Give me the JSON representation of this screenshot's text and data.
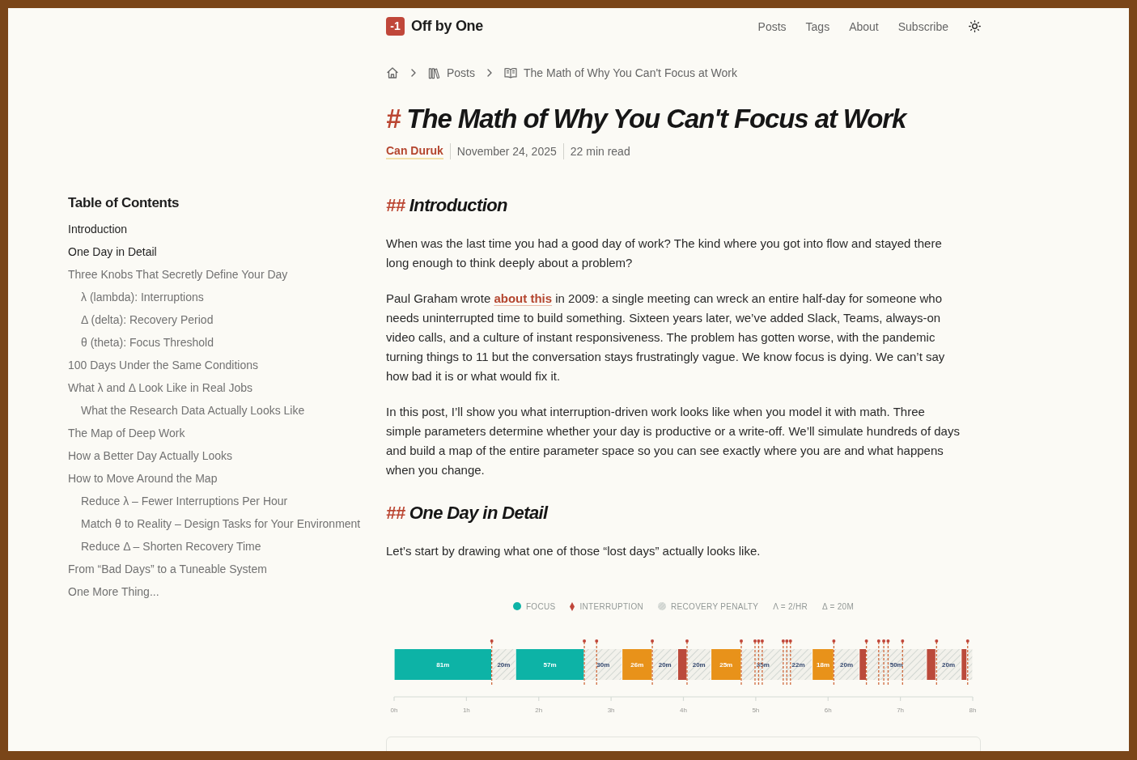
{
  "header": {
    "logo": {
      "mark": "-1",
      "name": "Off by One"
    },
    "nav": [
      {
        "label": "Posts"
      },
      {
        "label": "Tags"
      },
      {
        "label": "About"
      },
      {
        "label": "Subscribe"
      }
    ]
  },
  "toc": {
    "title": "Table of Contents",
    "items": [
      {
        "label": "Introduction",
        "active": true
      },
      {
        "label": "One Day in Detail",
        "active": true
      },
      {
        "label": "Three Knobs That Secretly Define Your Day",
        "active": false,
        "children": [
          {
            "label": "λ (lambda): Interruptions",
            "active": false
          },
          {
            "label": "Δ (delta): Recovery Period",
            "active": false
          },
          {
            "label": "θ (theta): Focus Threshold",
            "active": false
          }
        ]
      },
      {
        "label": "100 Days Under the Same Conditions",
        "active": false
      },
      {
        "label": "What λ and Δ Look Like in Real Jobs",
        "active": false,
        "children": [
          {
            "label": "What the Research Data Actually Looks Like",
            "active": false
          }
        ]
      },
      {
        "label": "The Map of Deep Work",
        "active": false
      },
      {
        "label": "How a Better Day Actually Looks",
        "active": false
      },
      {
        "label": "How to Move Around the Map",
        "active": false,
        "children": [
          {
            "label": "Reduce λ – Fewer Interruptions Per Hour",
            "active": false
          },
          {
            "label": "Match θ to Reality – Design Tasks for Your Environment",
            "active": false
          },
          {
            "label": "Reduce Δ – Shorten Recovery Time",
            "active": false
          }
        ]
      },
      {
        "label": "From “Bad Days” to a Tuneable System",
        "active": false
      },
      {
        "label": "One More Thing...",
        "active": false
      }
    ]
  },
  "breadcrumb": [
    {
      "kind": "home"
    },
    {
      "kind": "section",
      "label": "Posts"
    },
    {
      "kind": "page",
      "label": "The Math of Why You Can't Focus at Work"
    }
  ],
  "article": {
    "title": {
      "marker": "#",
      "text": "The Math of Why You Can't Focus at Work"
    },
    "meta": {
      "author": "Can Duruk",
      "date": "November 24, 2025",
      "read_time": "22 min read"
    },
    "blocks": [
      {
        "kind": "heading",
        "marker": "##",
        "text": "Introduction"
      },
      {
        "kind": "paragraph",
        "parts": [
          {
            "kind": "text",
            "text": "When was the last time you had a good day of work? The kind where you got into flow and stayed there long enough to think deeply about a problem?"
          }
        ]
      },
      {
        "kind": "paragraph",
        "parts": [
          {
            "kind": "text",
            "text": "Paul Graham wrote "
          },
          {
            "kind": "link",
            "text": "about this"
          },
          {
            "kind": "text",
            "text": " in 2009: a single meeting can wreck an entire half-day for someone who needs uninterrupted time to build something. Sixteen years later, we’ve added Slack, Teams, always-on video calls, and a culture of instant responsiveness. The problem has gotten worse, with the pandemic turning things to 11 but the conversation stays frustratingly vague. We know focus is dying. We can’t say how bad it is or what would fix it."
          }
        ]
      },
      {
        "kind": "paragraph",
        "parts": [
          {
            "kind": "text",
            "text": "In this post, I’ll show you what interruption-driven work looks like when you model it with math. Three simple parameters determine whether your day is productive or a write-off. We’ll simulate hundreds of days and build a map of the entire parameter space so you can see exactly where you are and what happens when you change."
          }
        ]
      },
      {
        "kind": "heading",
        "marker": "##",
        "text": "One Day in Detail"
      },
      {
        "kind": "paragraph",
        "parts": [
          {
            "kind": "text",
            "text": "Let’s start by drawing what one of those “lost days” actually looks like."
          }
        ]
      },
      {
        "kind": "figure",
        "legend": [
          {
            "kind": "focus",
            "label": "FOCUS",
            "color": "#0db3a6"
          },
          {
            "kind": "interruption",
            "label": "INTERRUPTION",
            "color": "#c0463a"
          },
          {
            "kind": "recovery",
            "label": "RECOVERY PENALTY",
            "color": "#cfd4d0"
          },
          {
            "kind": "param",
            "label": "Λ = 2/HR"
          },
          {
            "kind": "param",
            "label": "Δ = 20M"
          }
        ],
        "chart_data": {
          "type": "bar",
          "orientation": "horizontal",
          "stacked": true,
          "xlim": [
            0,
            8
          ],
          "xticks": [
            {
              "value": 0,
              "label": "0h"
            },
            {
              "value": 1,
              "label": "1h"
            },
            {
              "value": 2,
              "label": "2h"
            },
            {
              "value": 3,
              "label": "3h"
            },
            {
              "value": 4,
              "label": "4h"
            },
            {
              "value": 5,
              "label": "5h"
            },
            {
              "value": 6,
              "label": "6h"
            },
            {
              "value": 7,
              "label": "7h"
            },
            {
              "value": 8,
              "label": "8h"
            }
          ],
          "series": [
            {
              "name": "81m",
              "color": "#0db3a6",
              "values": [
                1.35
              ]
            },
            {
              "name": "20m",
              "color": "#cfd4d0",
              "values": [
                0.33
              ]
            },
            {
              "name": "57m",
              "color": "#0db3a6",
              "values": [
                0.95
              ]
            },
            {
              "name": "30m",
              "color": "#cfd4d0",
              "values": [
                0.52
              ]
            },
            {
              "name": "26m",
              "color": "#e8921a",
              "values": [
                0.42
              ]
            },
            {
              "name": "20m",
              "color": "#cfd4d0",
              "values": [
                0.35
              ]
            },
            {
              "color": "#bb4a3b",
              "values": [
                0.13
              ]
            },
            {
              "name": "20m",
              "color": "#cfd4d0",
              "values": [
                0.33
              ]
            },
            {
              "name": "25m",
              "color": "#e8921a",
              "values": [
                0.42
              ]
            },
            {
              "name": "35m",
              "color": "#cfd4d0",
              "values": [
                0.6
              ]
            },
            {
              "name": "22m",
              "color": "#cfd4d0",
              "values": [
                0.38
              ]
            },
            {
              "name": "18m",
              "color": "#e8921a",
              "values": [
                0.3
              ]
            },
            {
              "name": "20m",
              "color": "#cfd4d0",
              "values": [
                0.35
              ]
            },
            {
              "color": "#bb4a3b",
              "values": [
                0.1
              ]
            },
            {
              "name": "50m",
              "color": "#cfd4d0",
              "values": [
                0.83
              ]
            },
            {
              "color": "#bb4a3b",
              "values": [
                0.13
              ]
            },
            {
              "name": "20m",
              "color": "#cfd4d0",
              "values": [
                0.35
              ]
            },
            {
              "color": "#bb4a3b",
              "values": [
                0.08
              ]
            },
            {
              "color": "#cfd4d0",
              "values": [
                0.08
              ]
            }
          ],
          "ref_lines": [
            {
              "axis": "x",
              "value": 1.35
            },
            {
              "axis": "x",
              "value": 2.63
            },
            {
              "axis": "x",
              "value": 2.8
            },
            {
              "axis": "x",
              "value": 3.57
            },
            {
              "axis": "x",
              "value": 4.05
            },
            {
              "axis": "x",
              "value": 4.8
            },
            {
              "axis": "x",
              "value": 4.99
            },
            {
              "axis": "x",
              "value": 5.04
            },
            {
              "axis": "x",
              "value": 5.09
            },
            {
              "axis": "x",
              "value": 5.38
            },
            {
              "axis": "x",
              "value": 5.43
            },
            {
              "axis": "x",
              "value": 5.48
            },
            {
              "axis": "x",
              "value": 6.08
            },
            {
              "axis": "x",
              "value": 6.53
            },
            {
              "axis": "x",
              "value": 6.7
            },
            {
              "axis": "x",
              "value": 6.77
            },
            {
              "axis": "x",
              "value": 6.83
            },
            {
              "axis": "x",
              "value": 7.03
            },
            {
              "axis": "x",
              "value": 7.5
            },
            {
              "axis": "x",
              "value": 7.93
            }
          ]
        }
      },
      {
        "kind": "card"
      }
    ]
  }
}
